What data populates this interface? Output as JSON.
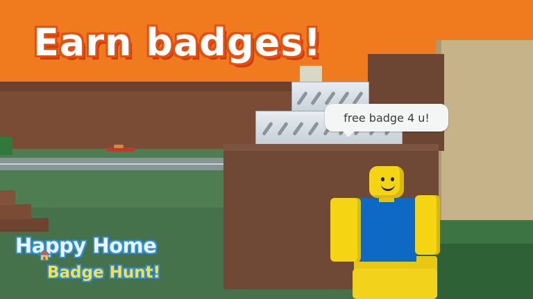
{
  "title": "Earn badges!",
  "speech_bubble": "free badge 4 u!",
  "logo": {
    "line1": "Happy Home",
    "line2": "Badge Hunt!"
  },
  "colors": {
    "banner": "#f07a1e",
    "title_outline": "#e44f12",
    "noob_yellow": "#f5d414",
    "noob_blue": "#0d69c4",
    "logo_blue": "#2f8fd1",
    "logo_yellow": "#f7e04a"
  },
  "icons": [
    "house-icon",
    "smiley-face"
  ]
}
